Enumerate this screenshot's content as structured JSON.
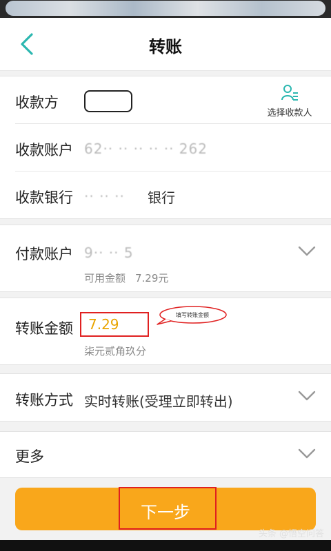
{
  "header": {
    "title": "转账",
    "back_icon": "chevron-left-icon"
  },
  "payee": {
    "label": "收款方",
    "picker_label": "选择收款人",
    "picker_icon": "person-list-icon"
  },
  "payee_account": {
    "label": "收款账户",
    "value": "62·· ·· ·· ·· ·· 262"
  },
  "payee_bank": {
    "label": "收款银行",
    "value_masked": "·· ·· ··",
    "value_suffix": "银行"
  },
  "payer_account": {
    "label": "付款账户",
    "value": "9·· ·· 5",
    "available_label": "可用金额",
    "available_value": "7.29元"
  },
  "amount": {
    "label": "转账金额",
    "value": "7.29",
    "in_words": "柒元贰角玖分",
    "annotation": "填写转账金额"
  },
  "method": {
    "label": "转账方式",
    "value": "实时转账(受理立即转出)"
  },
  "more": {
    "label": "更多"
  },
  "next_button": {
    "label": "下一步"
  },
  "watermark": "头条 @悟空问答",
  "colors": {
    "accent": "#f9a71b",
    "teal": "#2bb7b0",
    "highlight_red": "#e02020",
    "amount_text": "#e9a400"
  }
}
